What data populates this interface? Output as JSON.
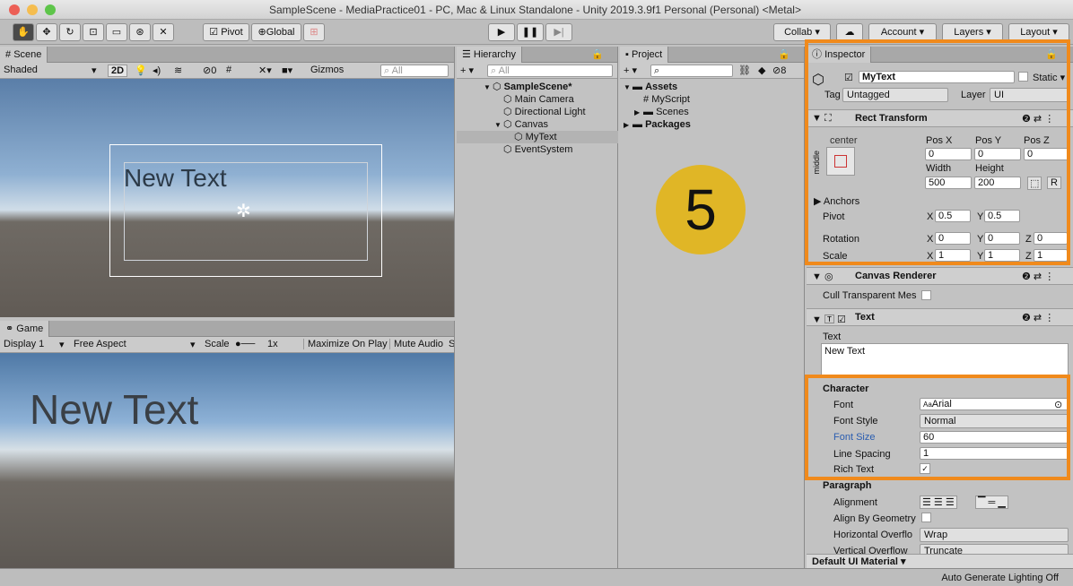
{
  "window": {
    "title": "SampleScene - MediaPractice01 - PC, Mac & Linux Standalone - Unity 2019.3.9f1 Personal (Personal) <Metal>",
    "traffic_colors": [
      "#ec5f56",
      "#f5bd4f",
      "#5ec54a"
    ]
  },
  "toolbar": {
    "pivot": "Pivot",
    "global": "Global",
    "collab": "Collab ▾",
    "account": "Account ▾",
    "layers": "Layers ▾",
    "layout": "Layout ▾"
  },
  "scene": {
    "tab": "Scene",
    "shading": "Shaded",
    "btn_2d": "2D",
    "hidden_count": "0",
    "gizmos": "Gizmos",
    "search_placeholder": "All",
    "canvas_text": "New Text"
  },
  "game": {
    "tab": "Game",
    "display": "Display 1",
    "aspect": "Free Aspect",
    "scale_label": "Scale",
    "scale_value": "1x",
    "maximize": "Maximize On Play",
    "mute": "Mute Audio",
    "s_cut": "S",
    "canvas_text": "New Text"
  },
  "hierarchy": {
    "tab": "Hierarchy",
    "search_placeholder": "All",
    "items": [
      {
        "label": "SampleScene*",
        "bold": true,
        "indent": 0,
        "arrow": "▼"
      },
      {
        "label": "Main Camera",
        "indent": 1,
        "arrow": ""
      },
      {
        "label": "Directional Light",
        "indent": 1,
        "arrow": ""
      },
      {
        "label": "Canvas",
        "indent": 1,
        "arrow": "▼"
      },
      {
        "label": "MyText",
        "indent": 2,
        "arrow": "",
        "selected": true
      },
      {
        "label": "EventSystem",
        "indent": 1,
        "arrow": ""
      }
    ]
  },
  "project": {
    "tab": "Project",
    "hidden_count": "8",
    "items": [
      {
        "label": "Assets",
        "bold": true,
        "indent": 0,
        "arrow": "▼",
        "icon": "folder-icon"
      },
      {
        "label": "MyScript",
        "indent": 1,
        "arrow": "",
        "icon": "script-icon"
      },
      {
        "label": "Scenes",
        "indent": 1,
        "arrow": "▶",
        "icon": "folder-icon"
      },
      {
        "label": "Packages",
        "bold": true,
        "indent": 0,
        "arrow": "▶",
        "icon": "folder-icon"
      }
    ],
    "badge": "5",
    "badge_color": "#e0b626"
  },
  "inspector": {
    "tab": "Inspector",
    "object_name": "MyText",
    "static_label": "Static ▾",
    "tag_label": "Tag",
    "tag_value": "Untagged",
    "layer_label": "Layer",
    "layer_value": "UI",
    "rect": {
      "header": "Rect Transform",
      "anchor_h": "center",
      "anchor_v": "middle",
      "posx_label": "Pos X",
      "posx": "0",
      "posy_label": "Pos Y",
      "posy": "0",
      "posz_label": "Pos Z",
      "posz": "0",
      "width_label": "Width",
      "width": "500",
      "height_label": "Height",
      "height": "200",
      "r_btn": "R",
      "anchors": "Anchors",
      "pivot": "Pivot",
      "pivot_x": "0.5",
      "pivot_y": "0.5",
      "rotation": "Rotation",
      "rot_x": "0",
      "rot_y": "0",
      "rot_z": "0",
      "scale": "Scale",
      "scale_x": "1",
      "scale_y": "1",
      "scale_z": "1",
      "x": "X",
      "y": "Y",
      "z": "Z"
    },
    "canvas_renderer": {
      "header": "Canvas Renderer",
      "cull": "Cull Transparent Mes"
    },
    "text": {
      "header": "Text",
      "text_label": "Text",
      "text_value": "New Text",
      "character": "Character",
      "font_label": "Font",
      "font_value": "Arial",
      "font_prefix": "Aa",
      "style_label": "Font Style",
      "style_value": "Normal",
      "size_label": "Font Size",
      "size_value": "60",
      "spacing_label": "Line Spacing",
      "spacing_value": "1",
      "rich_label": "Rich Text",
      "paragraph": "Paragraph",
      "alignment": "Alignment",
      "geometry": "Align By Geometry",
      "horiz": "Horizontal Overflo",
      "horiz_value": "Wrap",
      "vert": "Vertical Overflow",
      "vert_value": "Truncate"
    },
    "material": "Default UI Material ▾"
  },
  "status": {
    "text": "Auto Generate Lighting Off"
  },
  "colors": {
    "highlight": "#f08a1c",
    "selected_row": "#b3b3b3"
  }
}
